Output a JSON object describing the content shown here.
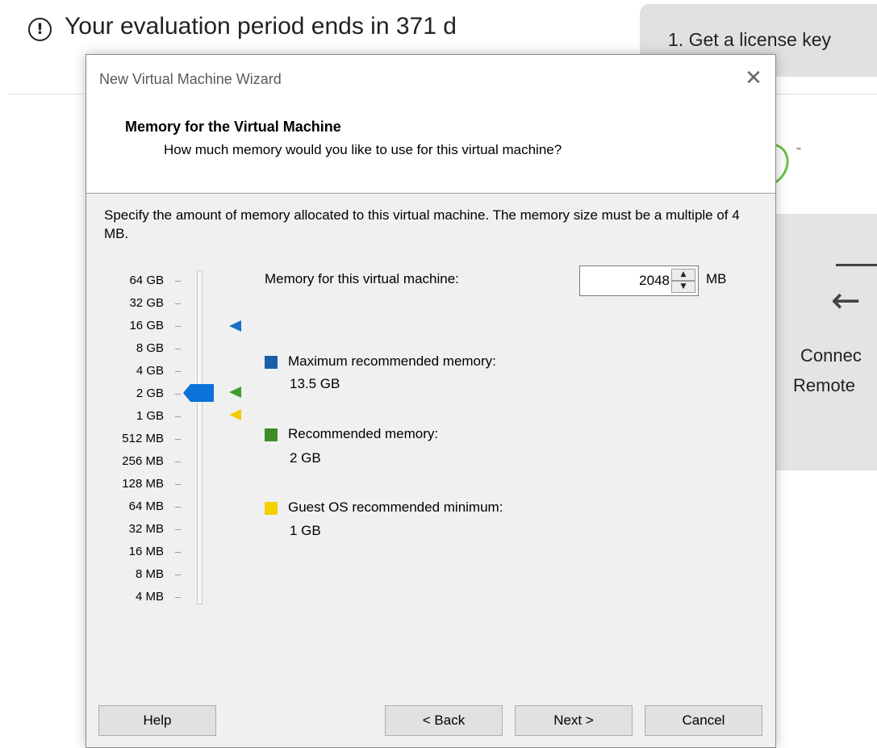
{
  "background": {
    "evaluation_text": "Your evaluation period ends in 371 d",
    "license_tab_label": "1. Get a license key",
    "connect_line1": "Connec",
    "connect_line2": "Remote",
    "trademark": "™",
    "icons": {
      "warning": "exclamation-circle-icon",
      "connect": "arrow-left-icon"
    }
  },
  "dialog": {
    "title": "New Virtual Machine Wizard",
    "close_glyph": "✕",
    "header_title": "Memory for the Virtual Machine",
    "header_subtitle": "How much memory would you like to use for this virtual machine?",
    "instructions": "Specify the amount of memory allocated to this virtual machine. The memory size must be a multiple of 4 MB.",
    "scale_labels": [
      "64 GB",
      "32 GB",
      "16 GB",
      "8 GB",
      "4 GB",
      "2 GB",
      "1 GB",
      "512 MB",
      "256 MB",
      "128 MB",
      "64 MB",
      "32 MB",
      "16 MB",
      "8 MB",
      "4 MB"
    ],
    "slider_value": "2 GB",
    "memory_label": "Memory for this virtual machine:",
    "memory_value": "2048",
    "memory_unit": "MB",
    "legend": [
      {
        "title": "Maximum recommended memory:",
        "value": "13.5 GB",
        "color": "#1a5fa8"
      },
      {
        "title": "Recommended memory:",
        "value": "2 GB",
        "color": "#3e8e27"
      },
      {
        "title": "Guest OS recommended minimum:",
        "value": "1 GB",
        "color": "#f2d100"
      }
    ],
    "marker_colors": {
      "max": "#1a6fc4",
      "recommended": "#3e9e2a",
      "minimum": "#f0cc00",
      "thumb": "#0a72d8"
    },
    "buttons": {
      "help": "Help",
      "back": "< Back",
      "next": "Next >",
      "cancel": "Cancel"
    }
  }
}
